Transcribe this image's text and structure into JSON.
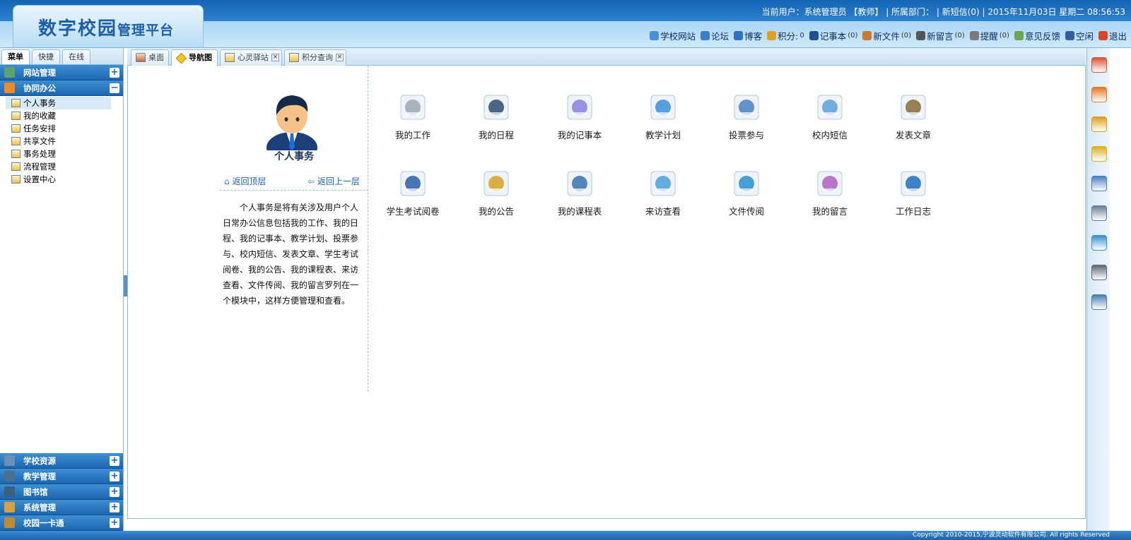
{
  "header": {
    "logo_main": "数字校园",
    "logo_sub": "管理平台",
    "user_info": "当前用户：系统管理员 【教师】 | 所属部门： | 新短信(0) | 2015年11月03日 星期二 08:56:53",
    "links": [
      {
        "label": "学校网站",
        "count": "",
        "color": "#4a8fd8"
      },
      {
        "label": "论坛",
        "count": "",
        "color": "#3d7fc4"
      },
      {
        "label": "博客",
        "count": "",
        "color": "#2f74bf"
      },
      {
        "label": "积分:",
        "count": "0",
        "color": "#e0a020"
      },
      {
        "label": "记事本",
        "count": "(0)",
        "color": "#1f4f8f"
      },
      {
        "label": "新文件",
        "count": "(0)",
        "color": "#c97a2a"
      },
      {
        "label": "新留言",
        "count": "(0)",
        "color": "#555555"
      },
      {
        "label": "提醒",
        "count": "(0)",
        "color": "#7a7a7a"
      },
      {
        "label": "意见反馈",
        "count": "",
        "color": "#6aa84f"
      },
      {
        "label": "空闲",
        "count": "",
        "color": "#2f5fa0"
      },
      {
        "label": "退出",
        "count": "",
        "color": "#d9442c"
      }
    ]
  },
  "sidebar": {
    "tabs": [
      "菜单",
      "快捷",
      "在线"
    ],
    "groups_top": [
      {
        "label": "网站管理",
        "toggle": "+",
        "icon_color": "#5aa46a"
      },
      {
        "label": "协同办公",
        "toggle": "−",
        "icon_color": "#f08a24"
      }
    ],
    "items": [
      "个人事务",
      "我的收藏",
      "任务安排",
      "共享文件",
      "事务处理",
      "流程管理",
      "设置中心"
    ],
    "groups_bottom": [
      {
        "label": "学校资源",
        "toggle": "+",
        "icon_color": "#6b8fb8"
      },
      {
        "label": "教学管理",
        "toggle": "+",
        "icon_color": "#4a6f8f"
      },
      {
        "label": "图书馆",
        "toggle": "+",
        "icon_color": "#3a5f7f"
      },
      {
        "label": "系统管理",
        "toggle": "+",
        "icon_color": "#d8a040"
      },
      {
        "label": "校园一卡通",
        "toggle": "+",
        "icon_color": "#c08a30"
      }
    ]
  },
  "tabs": [
    {
      "label": "桌面",
      "closable": false,
      "active": false
    },
    {
      "label": "导航图",
      "closable": false,
      "active": true
    },
    {
      "label": "心灵驿站",
      "closable": true,
      "active": false
    },
    {
      "label": "积分查询",
      "closable": true,
      "active": false
    }
  ],
  "panel": {
    "title": "个人事务",
    "back_top": "返回顶层",
    "back_up": "返回上一层",
    "description": "个人事务是将有关涉及用户个人日常办公信息包括我的工作、我的日程、我的记事本、教学计划、投票参与、校内短信、发表文章、学生考试阅卷、我的公告、我的课程表、来访查看、文件传阅、我的留言罗列在一个模块中，这样方便管理和查看。"
  },
  "grid": [
    {
      "label": "我的工作",
      "icon": "work-icon",
      "color": "#9aa7b4"
    },
    {
      "label": "我的日程",
      "icon": "calendar-icon",
      "color": "#2c4a6e"
    },
    {
      "label": "我的记事本",
      "icon": "notebook-icon",
      "color": "#8a7fe0"
    },
    {
      "label": "教学计划",
      "icon": "alarm-clock-icon",
      "color": "#3a8fd8"
    },
    {
      "label": "投票参与",
      "icon": "chart-search-icon",
      "color": "#4a7fc0"
    },
    {
      "label": "校内短信",
      "icon": "message-icon",
      "color": "#5aa0d8"
    },
    {
      "label": "发表文章",
      "icon": "book-icon",
      "color": "#8a6a3a"
    },
    {
      "label": "学生考试阅卷",
      "icon": "exam-pen-icon",
      "color": "#2a5fa8"
    },
    {
      "label": "我的公告",
      "icon": "megaphone-icon",
      "color": "#d8a020"
    },
    {
      "label": "我的课程表",
      "icon": "timetable-icon",
      "color": "#3a6fb0"
    },
    {
      "label": "来访查看",
      "icon": "visitor-icon",
      "color": "#4a9fd8"
    },
    {
      "label": "文件传阅",
      "icon": "monitor-icon",
      "color": "#2a8fd0"
    },
    {
      "label": "我的留言",
      "icon": "note-pen-icon",
      "color": "#b060c0"
    },
    {
      "label": "工作日志",
      "icon": "globe-icon",
      "color": "#1f6fc0"
    }
  ],
  "rightbar": [
    {
      "icon": "books-icon",
      "color": "#d8553a"
    },
    {
      "icon": "eraser-icon",
      "color": "#e07a2a"
    },
    {
      "icon": "pencil-icon",
      "color": "#d8a020"
    },
    {
      "icon": "key-icon",
      "color": "#d8b020"
    },
    {
      "icon": "user-icon",
      "color": "#4a7fc0"
    },
    {
      "icon": "document-icon",
      "color": "#6a7f9a"
    },
    {
      "icon": "download-icon",
      "color": "#3a8fd0"
    },
    {
      "icon": "printer-icon",
      "color": "#5a6a7a"
    },
    {
      "icon": "settings-icon",
      "color": "#4a7fb0"
    }
  ],
  "footer": {
    "copyright": "Copyright 2010-2015,宁波灵动软件有限公司. All rights Reserved"
  }
}
